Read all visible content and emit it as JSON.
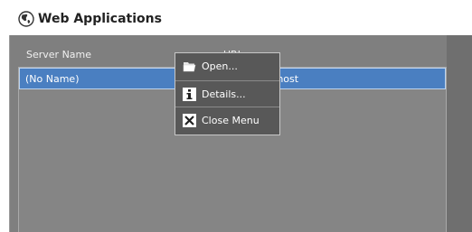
{
  "window": {
    "title": "Web Applications",
    "icon": "globe-icon"
  },
  "table": {
    "columns": [
      "Server Name",
      "URL"
    ],
    "rows": [
      {
        "server_name": "(No Name)",
        "url": "http://localhost",
        "selected": true
      }
    ]
  },
  "context_menu": {
    "items": [
      {
        "label": "Open...",
        "icon": "folder-open-icon"
      },
      {
        "label": "Details...",
        "icon": "info-icon"
      },
      {
        "label": "Close Menu",
        "icon": "close-icon"
      }
    ]
  },
  "colors": {
    "selection": "#4a7fc1",
    "background": "#7f7f7f",
    "menu_background": "#585858"
  }
}
